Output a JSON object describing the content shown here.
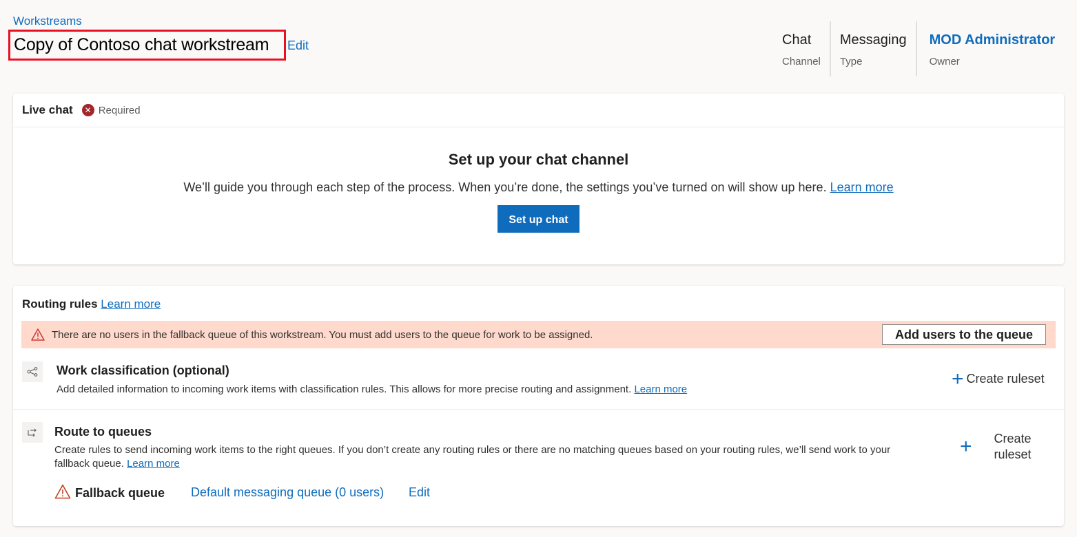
{
  "header": {
    "breadcrumb": "Workstreams",
    "title": "Copy of Contoso chat workstream",
    "edit_label": "Edit",
    "meta": [
      {
        "value": "Chat",
        "label": "Channel"
      },
      {
        "value": "Messaging",
        "label": "Type"
      },
      {
        "value": "MOD Administrator",
        "label": "Owner"
      }
    ]
  },
  "live_chat": {
    "title": "Live chat",
    "required_icon": "error-circle-icon",
    "required_label": "Required",
    "setup_title": "Set up your chat channel",
    "setup_desc": "We’ll guide you through each step of the process. When you’re done, the settings you’ve turned on will show up here.",
    "learn_more": "Learn more",
    "setup_button": "Set up chat"
  },
  "routing": {
    "title": "Routing rules",
    "learn_more": "Learn more",
    "warning": {
      "icon": "warning-icon",
      "text": "There are no users in the fallback queue of this workstream. You must add users to the queue for work to be assigned.",
      "button": "Add users to the queue"
    },
    "work_classification": {
      "icon": "share-icon",
      "title": "Work classification (optional)",
      "desc": "Add detailed information to incoming work items with classification rules. This allows for more precise routing and assignment.",
      "learn_more": "Learn more",
      "create_label": "Create ruleset"
    },
    "route_to_queues": {
      "icon": "route-arrows-icon",
      "title": "Route to queues",
      "desc": "Create rules to send incoming work items to the right queues. If you don’t create any routing rules or there are no matching queues based on your routing rules, we’ll send work to your fallback queue.",
      "learn_more": "Learn more",
      "create_label": "Create ruleset"
    },
    "fallback": {
      "label": "Fallback queue",
      "queue": "Default messaging queue (0 users)",
      "edit": "Edit"
    }
  },
  "colors": {
    "accent": "#0f6cbd",
    "warning_bg": "#fed9cc",
    "error": "#a4262c",
    "highlight_border": "#e81123"
  }
}
